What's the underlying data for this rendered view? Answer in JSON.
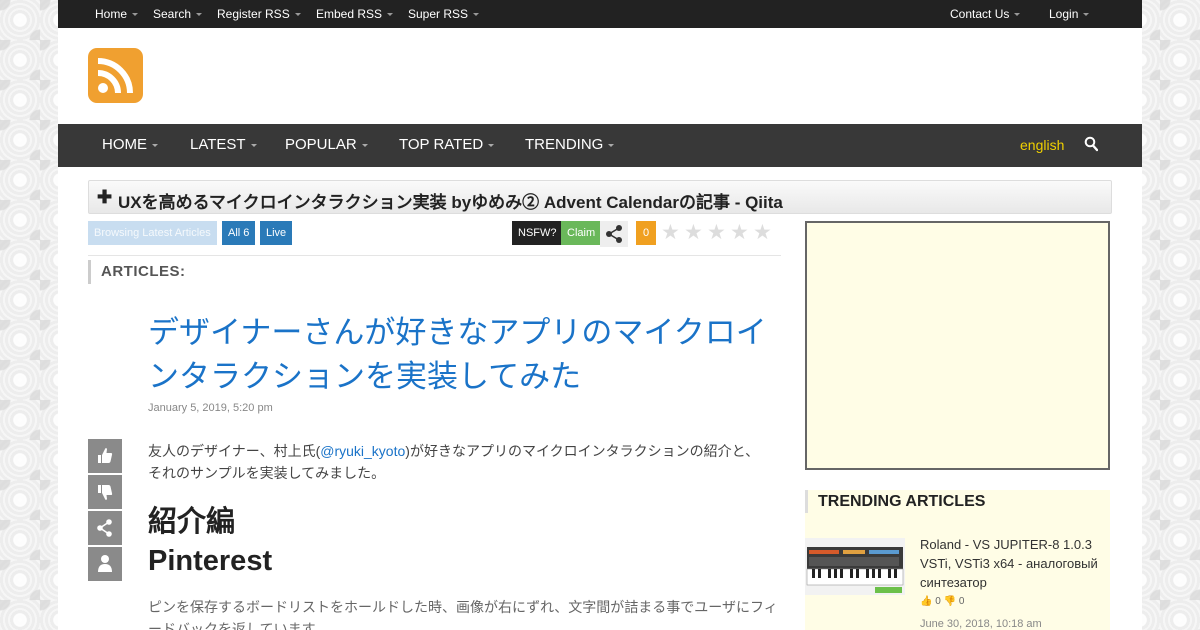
{
  "topnav": {
    "left": [
      "Home",
      "Search",
      "Register RSS",
      "Embed RSS",
      "Super RSS"
    ],
    "right": [
      "Contact Us",
      "Login"
    ]
  },
  "mainnav": {
    "items": [
      "HOME",
      "LATEST",
      "POPULAR",
      "TOP RATED",
      "TRENDING"
    ],
    "language": "english"
  },
  "feed": {
    "title": "UXを高めるマイクロインタラクション実装 byゆめみ② Advent Calendarの記事 - Qiita"
  },
  "tags": {
    "browsing": "Browsing Latest Articles",
    "all": "All 6",
    "live": "Live",
    "nsfw": "NSFW?",
    "claim": "Claim",
    "count": "0"
  },
  "rating": {
    "stars": 0,
    "max": 5
  },
  "articles_label": "ARTICLES:",
  "post": {
    "title": "デザイナーさんが好きなアプリのマイクロインタラクションを実装してみた",
    "date": "January 5, 2019, 5:20 pm",
    "intro_before": "友人のデザイナー、村上氏(",
    "intro_link": "@ryuki_kyoto",
    "intro_after": ")が好きなアプリのマイクロインタラクションの紹介と、それのサンプルを実装してみました。",
    "heading1": "紹介編",
    "heading2": "Pinterest",
    "pin_text": "ピンを保存するボードリストをホールドした時、画像が右にずれ、文字間が詰まる事でユーザにフィードバックを返しています。"
  },
  "trending": {
    "heading": "TRENDING ARTICLES",
    "items": [
      {
        "title": "Roland - VS JUPITER-8 1.0.3 VSTi, VSTi3 x64 - аналоговый синтезатор",
        "likes": "0",
        "dislikes": "0",
        "date": "June 30, 2018, 10:18 am"
      }
    ]
  },
  "colors": {
    "topbar": "#222222",
    "mainnav": "#383838",
    "logo": "#f0a030",
    "link": "#1a73c8",
    "language": "#f0d000",
    "tag_blue": "#2a7ab8",
    "tag_green": "#6ab85a",
    "tag_count": "#f0a020"
  },
  "icons": {
    "logo": "rss-icon",
    "search": "search-icon",
    "share": "share-icon",
    "like": "thumbs-up-icon",
    "dislike": "thumbs-down-icon",
    "user": "user-icon",
    "plus": "plus-icon",
    "star": "star-icon"
  }
}
